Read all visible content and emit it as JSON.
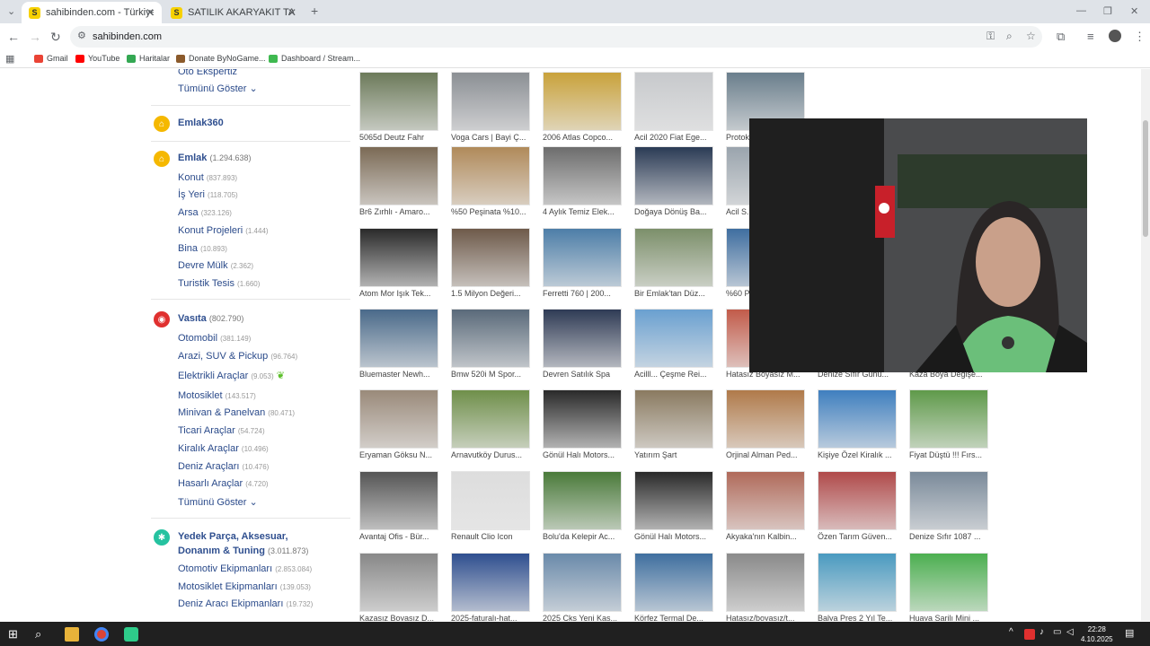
{
  "browser": {
    "tabs": [
      {
        "favicon": "S",
        "title": "sahibinden.com - Türkiye'nin O..."
      },
      {
        "favicon": "S",
        "title": "SATILIK AKARYAKIT TANKERI - ..."
      }
    ],
    "url": "sahibinden.com",
    "bookmarks": [
      "Gmail",
      "YouTube",
      "Haritalar",
      "Donate ByNoGame...",
      "Dashboard / Stream..."
    ]
  },
  "sidebar": {
    "partial_top": "Oto Ekspertiz",
    "show_all_1": "Tümünü Göster",
    "emlak360": "Emlak360",
    "emlak": {
      "title": "Emlak",
      "count": "(1.294.638)",
      "items": [
        {
          "label": "Konut",
          "count": "(837.893)"
        },
        {
          "label": "İş Yeri",
          "count": "(118.705)"
        },
        {
          "label": "Arsa",
          "count": "(323.126)"
        },
        {
          "label": "Konut Projeleri",
          "count": "(1.444)"
        },
        {
          "label": "Bina",
          "count": "(10.893)"
        },
        {
          "label": "Devre Mülk",
          "count": "(2.362)"
        },
        {
          "label": "Turistik Tesis",
          "count": "(1.660)"
        }
      ]
    },
    "vasita": {
      "title": "Vasıta",
      "count": "(802.790)",
      "items": [
        {
          "label": "Otomobil",
          "count": "(381.149)"
        },
        {
          "label": "Arazi, SUV & Pickup",
          "count": "(96.764)"
        },
        {
          "label": "Elektrikli Araçlar",
          "count": "(9.053)"
        },
        {
          "label": "Motosiklet",
          "count": "(143.517)"
        },
        {
          "label": "Minivan & Panelvan",
          "count": "(80.471)"
        },
        {
          "label": "Ticari Araçlar",
          "count": "(54.724)"
        },
        {
          "label": "Kiralık Araçlar",
          "count": "(10.496)"
        },
        {
          "label": "Deniz Araçları",
          "count": "(10.476)"
        },
        {
          "label": "Hasarlı Araçlar",
          "count": "(4.720)"
        }
      ],
      "show_all": "Tümünü Göster"
    },
    "yedek": {
      "title_line1": "Yedek Parça, Aksesuar,",
      "title_line2": "Donanım & Tuning",
      "count": "(3.011.873)",
      "items": [
        {
          "label": "Otomotiv Ekipmanları",
          "count": "(2.853.084)"
        },
        {
          "label": "Motosiklet Ekipmanları",
          "count": "(139.053)"
        },
        {
          "label": "Deniz Aracı Ekipmanları",
          "count": "(19.732)"
        }
      ]
    }
  },
  "listings": [
    [
      "5065d Deutz Fahr",
      "Voga Cars | Bayi Ç...",
      "2006 Atlas Copco...",
      "Acil 2020 Fiat Ege...",
      "Protok...",
      "",
      ""
    ],
    [
      "Br6 Zırhlı - Amaro...",
      "%50 Peşinata %10...",
      "4 Aylık Temiz Elek...",
      "Doğaya Dönüş Ba...",
      "Acil S...",
      "",
      ""
    ],
    [
      "Atom Mor Işık Tek...",
      "1.5 Milyon Değeri...",
      "Ferretti 760 | 200...",
      "Bir Emlak'tan Düz...",
      "%60 P...",
      "",
      ""
    ],
    [
      "Bluemaster Newh...",
      "Bmw 520i M Spor...",
      "Devren Satılık Spa",
      "Acilll... Çeşme Rei...",
      "Hatasız Boyasız M...",
      "Denize Sıfır Günü...",
      "Kaza Boya Değişe..."
    ],
    [
      "Eryaman Göksu N...",
      "Arnavutköy Durus...",
      "Gönül Halı Motors...",
      "Yatırım Şart",
      "Orjinal Alman Ped...",
      "Kişiye Özel Kiralık ...",
      "Fiyat Düştü !!! Fırs..."
    ],
    [
      "Avantaj Ofis - Bür...",
      "Renault Clio Icon",
      "Bolu'da Kelepir Ac...",
      "Gönül Halı Motors...",
      "Akyaka'nın Kalbin...",
      "Özen Tarım Güven...",
      "Denize Sıfır 1087 ..."
    ],
    [
      "Kazasız Boyasız D...",
      "2025-faturalı-hat...",
      "2025 Cks Yeni Kas...",
      "Körfez Termal De...",
      "Hatasız/boyasız/t...",
      "Balya Pres 2 Yıl Te...",
      "Huaya Şarjlı Mini ..."
    ]
  ],
  "taskbar": {
    "time": "22:28",
    "date": "4.10.2025"
  },
  "colors": {
    "emlak": "#f5b800",
    "vasita": "#e0302f",
    "yedek": "#25c2a0",
    "link": "#2a4a8a"
  }
}
